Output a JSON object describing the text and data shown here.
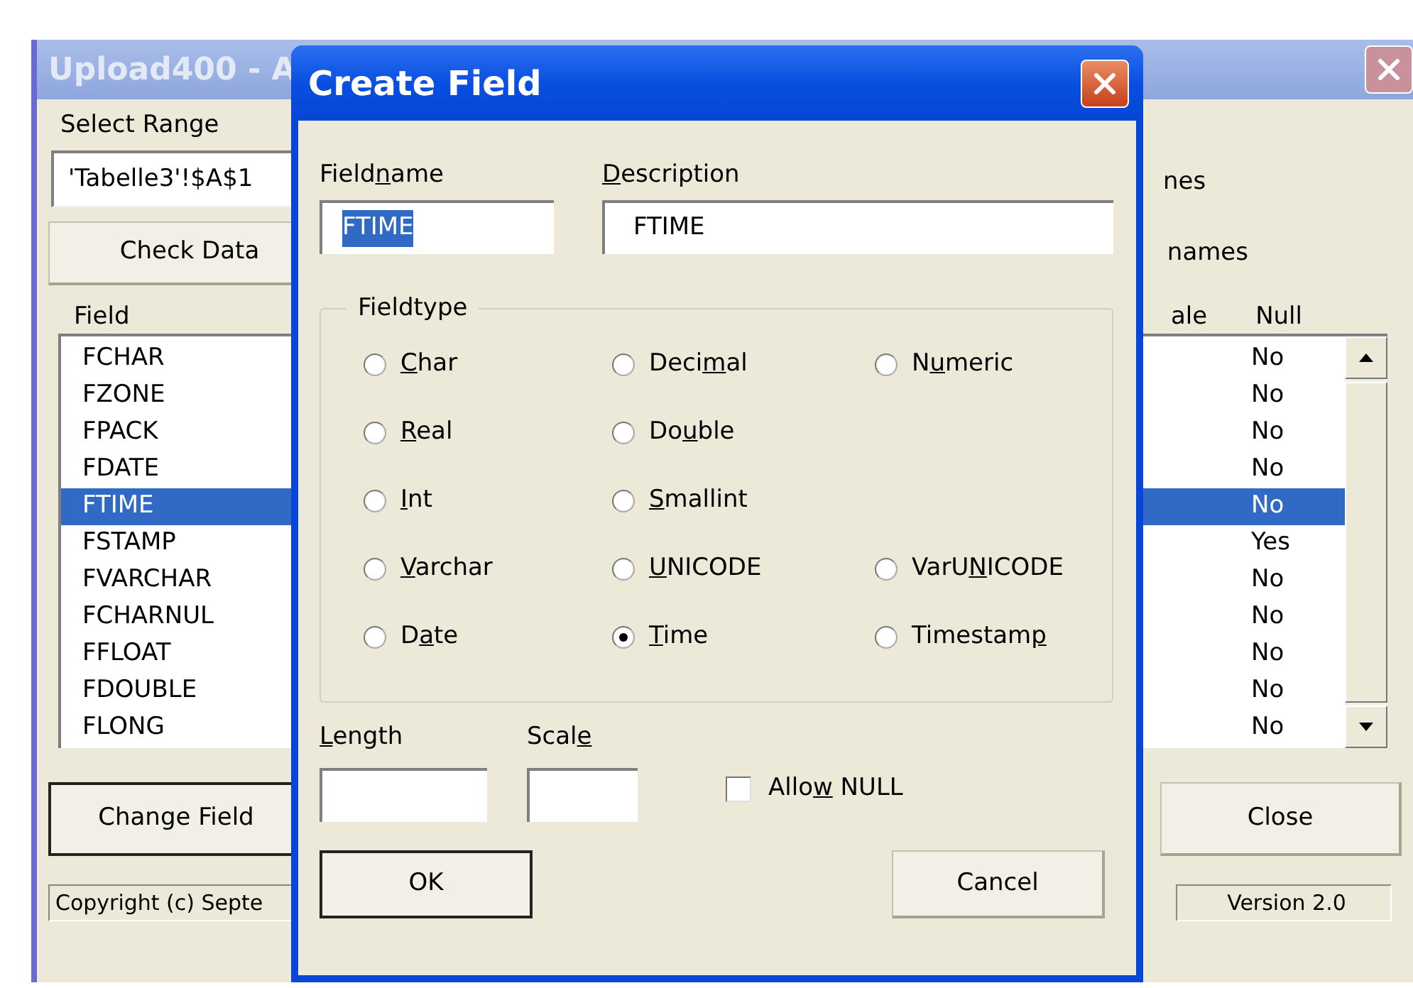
{
  "main_window": {
    "title": "Upload400 - A",
    "range_label": "Select Range",
    "range_value": "'Tabelle3'!$A$1",
    "check_button": "Check Data",
    "option_1": "nes",
    "option_2": "names",
    "columns": [
      "Field",
      "ale",
      "Null"
    ],
    "fields": [
      {
        "name": "FCHAR",
        "null": "No",
        "selected": false
      },
      {
        "name": "FZONE",
        "null": "No",
        "selected": false
      },
      {
        "name": "FPACK",
        "null": "No",
        "selected": false
      },
      {
        "name": "FDATE",
        "null": "No",
        "selected": false
      },
      {
        "name": "FTIME",
        "null": "No",
        "selected": true
      },
      {
        "name": "FSTAMP",
        "null": "Yes",
        "selected": false
      },
      {
        "name": "FVARCHAR",
        "null": "No",
        "selected": false
      },
      {
        "name": "FCHARNUL",
        "null": "No",
        "selected": false
      },
      {
        "name": "FFLOAT",
        "null": "No",
        "selected": false
      },
      {
        "name": "FDOUBLE",
        "null": "No",
        "selected": false
      },
      {
        "name": "FLONG",
        "null": "No",
        "selected": false
      }
    ],
    "change_button": "Change Field",
    "close_button": "Close",
    "status_left": "Copyright (c) Septe",
    "status_right": "Version 2.0"
  },
  "dialog": {
    "title": "Create Field",
    "fieldname_label": [
      {
        "text": "Field",
        "underlined": false
      },
      {
        "text": "n",
        "underlined": true
      },
      {
        "text": "ame",
        "underlined": false
      }
    ],
    "fieldname_value": "FTIME",
    "description_label": [
      {
        "text": "D",
        "underlined": true
      },
      {
        "text": "escription",
        "underlined": false
      }
    ],
    "description_value": "FTIME",
    "fieldtype_label": "Fieldtype",
    "fieldtype_rows": [
      [
        {
          "label": [
            {
              "text": "C",
              "underlined": true
            },
            {
              "text": "har",
              "underlined": false
            }
          ],
          "selected": false
        },
        {
          "label": [
            {
              "text": "Deci",
              "underlined": false
            },
            {
              "text": "m",
              "underlined": true
            },
            {
              "text": "al",
              "underlined": false
            }
          ],
          "selected": false
        },
        {
          "label": [
            {
              "text": "N",
              "underlined": false
            },
            {
              "text": "u",
              "underlined": true
            },
            {
              "text": "meric",
              "underlined": false
            }
          ],
          "selected": false
        }
      ],
      [
        {
          "label": [
            {
              "text": "R",
              "underlined": true
            },
            {
              "text": "eal",
              "underlined": false
            }
          ],
          "selected": false
        },
        {
          "label": [
            {
              "text": "Do",
              "underlined": false
            },
            {
              "text": "u",
              "underlined": true
            },
            {
              "text": "ble",
              "underlined": false
            }
          ],
          "selected": false
        }
      ],
      [
        {
          "label": [
            {
              "text": "I",
              "underlined": true
            },
            {
              "text": "nt",
              "underlined": false
            }
          ],
          "selected": false
        },
        {
          "label": [
            {
              "text": "S",
              "underlined": true
            },
            {
              "text": "mallint",
              "underlined": false
            }
          ],
          "selected": false
        }
      ],
      [
        {
          "label": [
            {
              "text": "V",
              "underlined": true
            },
            {
              "text": "archar",
              "underlined": false
            }
          ],
          "selected": false
        },
        {
          "label": [
            {
              "text": "U",
              "underlined": true
            },
            {
              "text": "NICODE",
              "underlined": false
            }
          ],
          "selected": false
        },
        {
          "label": [
            {
              "text": "VarU",
              "underlined": false
            },
            {
              "text": "N",
              "underlined": true
            },
            {
              "text": "ICODE",
              "underlined": false
            }
          ],
          "selected": false
        }
      ],
      [
        {
          "label": [
            {
              "text": "D",
              "underlined": false
            },
            {
              "text": "a",
              "underlined": true
            },
            {
              "text": "te",
              "underlined": false
            }
          ],
          "selected": false
        },
        {
          "label": [
            {
              "text": "T",
              "underlined": true
            },
            {
              "text": "ime",
              "underlined": false
            }
          ],
          "selected": true
        },
        {
          "label": [
            {
              "text": "Timestam",
              "underlined": false
            },
            {
              "text": "p",
              "underlined": true
            }
          ],
          "selected": false
        }
      ]
    ],
    "length_label": [
      {
        "text": "L",
        "underlined": true
      },
      {
        "text": "ength",
        "underlined": false
      }
    ],
    "scale_label": [
      {
        "text": "Scal",
        "underlined": false
      },
      {
        "text": "e",
        "underlined": true
      }
    ],
    "allow_null": {
      "label": [
        {
          "text": "Allo",
          "underlined": false
        },
        {
          "text": "w",
          "underlined": true
        },
        {
          "text": " NULL",
          "underlined": false
        }
      ],
      "checked": false
    },
    "ok_button": "OK",
    "cancel_button": "Cancel"
  }
}
